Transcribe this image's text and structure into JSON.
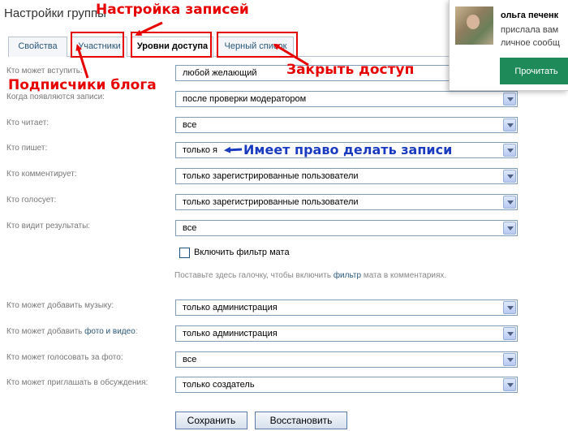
{
  "page": {
    "title": "Настройки группы"
  },
  "tabs": [
    {
      "label": "Свойства",
      "active": false
    },
    {
      "label": "Участники",
      "active": false
    },
    {
      "label": "Уровни доступа",
      "active": true
    },
    {
      "label": "Черный список",
      "active": false
    }
  ],
  "form": {
    "rows": [
      {
        "label": "Кто может вступить:",
        "value": "любой желающий"
      },
      {
        "label": "Когда появляются записи:",
        "value": "после проверки модератором"
      },
      {
        "label": "Кто читает:",
        "value": "все"
      },
      {
        "label": "Кто пишет:",
        "value": "только я"
      },
      {
        "label": "Кто комментирует:",
        "value": "только зарегистрированные пользователи"
      },
      {
        "label": "Кто голосует:",
        "value": "только зарегистрированные пользователи"
      },
      {
        "label": "Кто видит результаты:",
        "value": "все"
      }
    ],
    "filter": {
      "label": "Включить фильтр мата",
      "checked": false,
      "hint_before": "Поставьте здесь галочку, чтобы включить",
      "hint_link": "фильтр",
      "hint_after": "мата в комментариях."
    },
    "rows2": [
      {
        "label": "Кто может добавить музыку:",
        "value": "только администрация"
      },
      {
        "label_before": "Кто может добавить",
        "label_link": "фото и видео",
        "label_after": ":",
        "value": "только администрация"
      },
      {
        "label": "Кто может голосовать за фото:",
        "value": "все"
      },
      {
        "label": "Кто может приглашать в обсуждения:",
        "value": "только создатель"
      }
    ],
    "save_label": "Сохранить",
    "reset_label": "Восстановить"
  },
  "annotations": {
    "settings_records": "Настройка записей",
    "blog_subscribers": "Подписчики блога",
    "close_access": "Закрыть доступ",
    "can_post": "Имеет право делать записи"
  },
  "notification": {
    "name": "ольга печенк",
    "line1": "прислала вам",
    "line2": "личное сообщ",
    "button_label": "Прочитать"
  },
  "colors": {
    "annotation_red": "#e60000",
    "annotation_blue": "#1a3bbf",
    "notification_button": "#1e8a5a",
    "link": "#2b587a"
  }
}
